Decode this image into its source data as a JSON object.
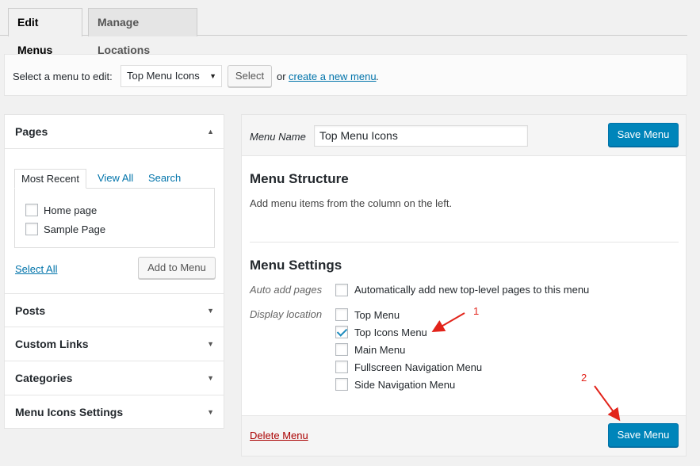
{
  "tabs": {
    "edit": "Edit Menus",
    "manage": "Manage Locations"
  },
  "manage_bar": {
    "label": "Select a menu to edit:",
    "selected_menu": "Top Menu Icons",
    "select_button": "Select",
    "or_text": "or",
    "create_link": "create a new menu",
    "trailing": "."
  },
  "left_panel": {
    "pages_title": "Pages",
    "inner_tabs": [
      "Most Recent",
      "View All",
      "Search"
    ],
    "pages": [
      "Home page",
      "Sample Page"
    ],
    "select_all": "Select All",
    "add_button": "Add to Menu",
    "sections": [
      "Posts",
      "Custom Links",
      "Categories",
      "Menu Icons Settings"
    ]
  },
  "right_panel": {
    "menu_name_label": "Menu Name",
    "menu_name_value": "Top Menu Icons",
    "save_label": "Save Menu",
    "structure_title": "Menu Structure",
    "structure_desc": "Add menu items from the column on the left.",
    "settings_title": "Menu Settings",
    "auto_add_label": "Auto add pages",
    "auto_add_text": "Automatically add new top-level pages to this menu",
    "display_location_label": "Display location",
    "locations": [
      {
        "label": "Top Menu",
        "checked": false
      },
      {
        "label": "Top Icons Menu",
        "checked": true
      },
      {
        "label": "Main Menu",
        "checked": false
      },
      {
        "label": "Fullscreen Navigation Menu",
        "checked": false
      },
      {
        "label": "Side Navigation Menu",
        "checked": false
      }
    ],
    "delete_link": "Delete Menu"
  },
  "annotations": {
    "one": "1",
    "two": "2",
    "color": "#e2231a"
  },
  "colors": {
    "primary": "#0085ba",
    "link": "#0073aa",
    "delete": "#aa0000"
  }
}
